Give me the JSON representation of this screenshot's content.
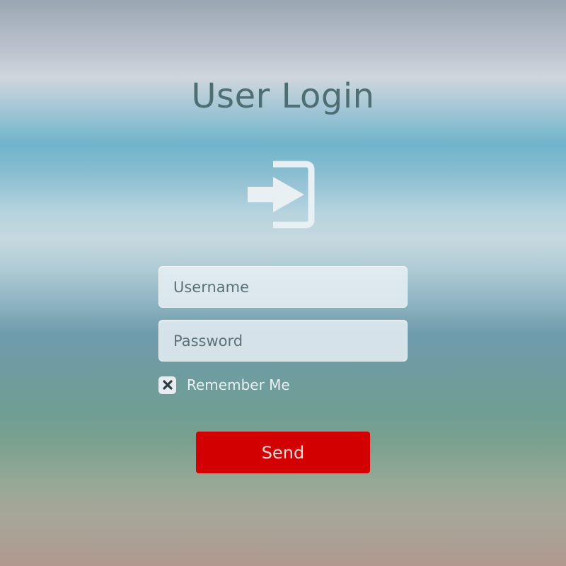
{
  "title": "User Login",
  "icons": {
    "login": "login-enter-icon",
    "checkbox_mark": "x-icon"
  },
  "username": {
    "placeholder": "Username",
    "value": ""
  },
  "password": {
    "placeholder": "Password",
    "value": ""
  },
  "remember": {
    "label": "Remember Me",
    "checked": true
  },
  "send": {
    "label": "Send"
  },
  "colors": {
    "title": "#4f6e74",
    "button": "#d20000",
    "field": "#ebf2f6",
    "icon": "#e8f0f4"
  }
}
